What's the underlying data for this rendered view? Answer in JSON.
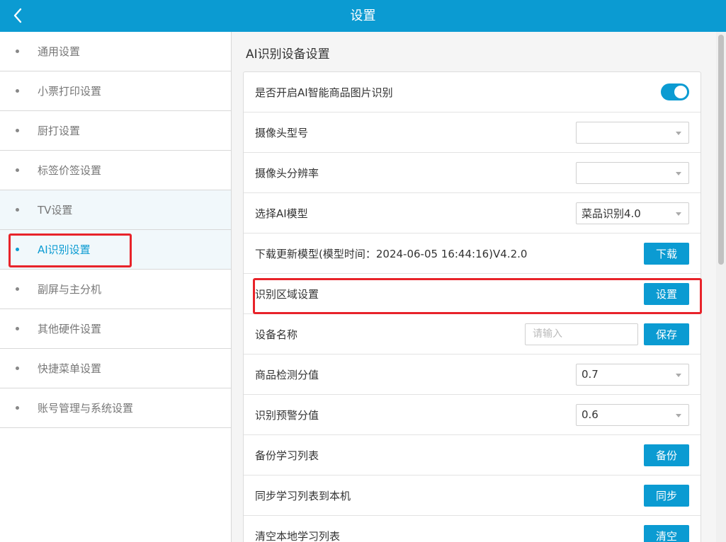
{
  "header": {
    "title": "设置"
  },
  "sidebar": {
    "items": [
      {
        "label": "通用设置"
      },
      {
        "label": "小票打印设置"
      },
      {
        "label": "厨打设置"
      },
      {
        "label": "标签价签设置"
      },
      {
        "label": "TV设置"
      },
      {
        "label": "AI识别设置"
      },
      {
        "label": "副屏与主分机"
      },
      {
        "label": "其他硬件设置"
      },
      {
        "label": "快捷菜单设置"
      },
      {
        "label": "账号管理与系统设置"
      }
    ],
    "active_index": 5
  },
  "main": {
    "title": "AI识别设备设置",
    "rows": {
      "ai_toggle": {
        "label": "是否开启AI智能商品图片识别",
        "enabled": true
      },
      "camera_model": {
        "label": "摄像头型号",
        "value": ""
      },
      "camera_resolution": {
        "label": "摄像头分辨率",
        "value": ""
      },
      "ai_model": {
        "label": "选择AI模型",
        "value": "菜品识别4.0"
      },
      "download_model": {
        "label": "下载更新模型(模型时间：2024-06-05 16:44:16)V4.2.0",
        "button": "下载"
      },
      "region": {
        "label": "识别区域设置",
        "button": "设置"
      },
      "device_name": {
        "label": "设备名称",
        "placeholder": "请输入",
        "value": "",
        "button": "保存"
      },
      "detect_threshold": {
        "label": "商品检测分值",
        "value": "0.7"
      },
      "warning_threshold": {
        "label": "识别预警分值",
        "value": "0.6"
      },
      "backup": {
        "label": "备份学习列表",
        "button": "备份"
      },
      "sync": {
        "label": "同步学习列表到本机",
        "button": "同步"
      },
      "clear": {
        "label": "清空本地学习列表",
        "button": "清空"
      }
    }
  },
  "colors": {
    "accent": "#0b9bd2",
    "highlight": "#e8232a"
  }
}
